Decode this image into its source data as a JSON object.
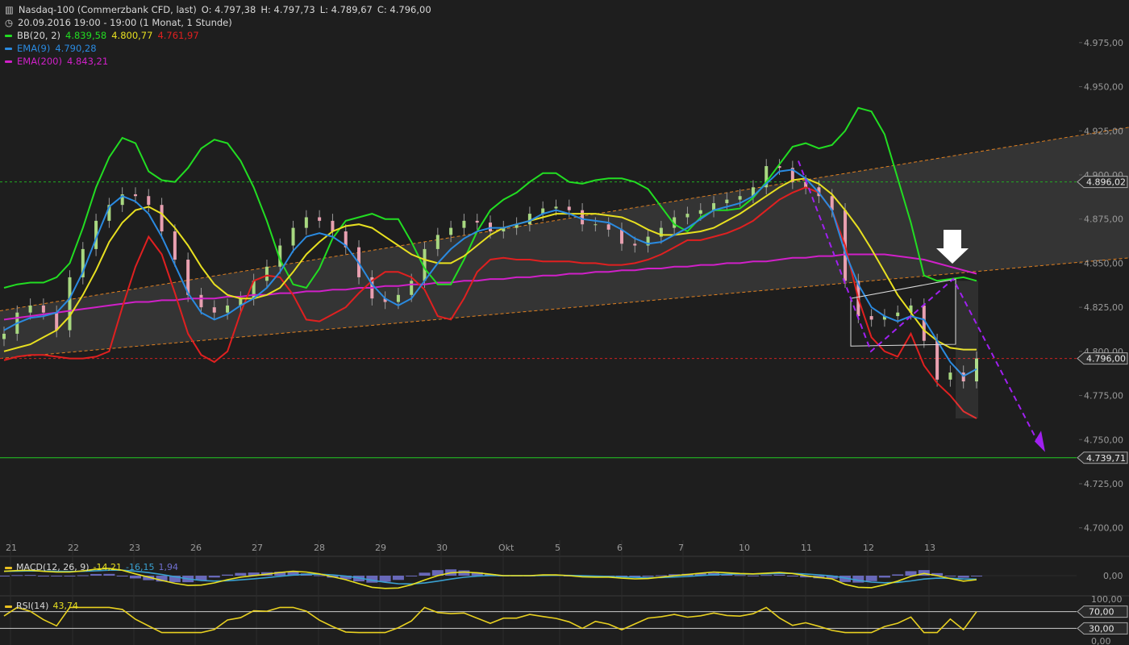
{
  "header": {
    "title": "Nasdaq-100 (Commerzbank CFD, last)",
    "ohlc": {
      "o": "O: 4.797,38",
      "h": "H: 4.797,73",
      "l": "L: 4.789,67",
      "c": "C: 4.796,00"
    },
    "period": "20.09.2016 19:00 - 19:00 (1 Monat, 1 Stunde)"
  },
  "legend": [
    {
      "name": "BB(20, 2)",
      "values": [
        "4.839,58",
        "4.800,77",
        "4.761,97"
      ],
      "colors": [
        "#22dd22",
        "#e8e020",
        "#e02020"
      ]
    },
    {
      "name": "EMA(9)",
      "values": [
        "4.790,28"
      ],
      "colors": [
        "#2a8ae0"
      ]
    },
    {
      "name": "EMA(200)",
      "values": [
        "4.843,21"
      ],
      "colors": [
        "#d020c8"
      ]
    }
  ],
  "macd_label": {
    "name": "MACD(12, 26, 9)",
    "v1": "-14,21",
    "v2": "-16,15",
    "v3": "1,94"
  },
  "rsi_label": {
    "name": "RSI(14)",
    "value": "43,74"
  },
  "chart_data": {
    "type": "candlestick",
    "y_axis": {
      "ticks": [
        "4.975,00",
        "4.950,00",
        "4.925,00",
        "4.900,00",
        "4.875,00",
        "4.850,00",
        "4.825,00",
        "4.800,00",
        "4.775,00",
        "4.750,00",
        "4.725,00",
        "4.700,00"
      ],
      "tick_values": [
        4975,
        4950,
        4925,
        4900,
        4875,
        4850,
        4825,
        4800,
        4775,
        4750,
        4725,
        4700
      ],
      "range": [
        4693,
        4990
      ]
    },
    "x_axis": {
      "labels": [
        "21",
        "22",
        "23",
        "26",
        "27",
        "28",
        "29",
        "30",
        "Okt",
        "5",
        "6",
        "7",
        "10",
        "11",
        "12",
        "13"
      ]
    },
    "price_markers": [
      {
        "label": "4.896,02",
        "value": 4896.02,
        "color": "#22aa22",
        "style": "dashed"
      },
      {
        "label": "4.796,00",
        "value": 4796.0,
        "color": "#cc2020",
        "style": "dashed"
      },
      {
        "label": "4.739,71",
        "value": 4739.71,
        "color": "#22cc22",
        "style": "solid"
      }
    ],
    "series": {
      "bb_upper": [
        4836,
        4838,
        4839,
        4839,
        4842,
        4850,
        4870,
        4893,
        4910,
        4921,
        4918,
        4902,
        4897,
        4896,
        4904,
        4915,
        4920,
        4918,
        4908,
        4893,
        4874,
        4852,
        4838,
        4836,
        4847,
        4864,
        4874,
        4876,
        4878,
        4875,
        4875,
        4862,
        4847,
        4838,
        4838,
        4852,
        4868,
        4880,
        4886,
        4890,
        4896,
        4901,
        4901,
        4896,
        4895,
        4897,
        4898,
        4898,
        4896,
        4892,
        4882,
        4872,
        4868,
        4876,
        4880,
        4880,
        4881,
        4887,
        4896,
        4906,
        4916,
        4918,
        4915,
        4917,
        4925,
        4938,
        4936,
        4923,
        4898,
        4873,
        4843,
        4840,
        4841,
        4842,
        4840
      ],
      "bb_middle": [
        4800,
        4802,
        4804,
        4808,
        4812,
        4820,
        4832,
        4846,
        4862,
        4873,
        4880,
        4882,
        4878,
        4870,
        4860,
        4848,
        4838,
        4832,
        4830,
        4830,
        4832,
        4836,
        4845,
        4855,
        4862,
        4868,
        4871,
        4872,
        4870,
        4865,
        4860,
        4855,
        4852,
        4850,
        4850,
        4854,
        4860,
        4866,
        4870,
        4872,
        4874,
        4876,
        4878,
        4878,
        4878,
        4878,
        4877,
        4876,
        4873,
        4869,
        4866,
        4866,
        4867,
        4868,
        4870,
        4874,
        4878,
        4883,
        4888,
        4893,
        4897,
        4898,
        4895,
        4889,
        4880,
        4870,
        4858,
        4845,
        4832,
        4822,
        4812,
        4806,
        4802,
        4801,
        4801
      ],
      "bb_lower": [
        4795,
        4797,
        4798,
        4798,
        4797,
        4796,
        4796,
        4797,
        4800,
        4825,
        4848,
        4865,
        4855,
        4833,
        4810,
        4798,
        4794,
        4800,
        4822,
        4840,
        4843,
        4842,
        4832,
        4818,
        4817,
        4821,
        4825,
        4833,
        4840,
        4845,
        4845,
        4842,
        4835,
        4820,
        4818,
        4830,
        4845,
        4852,
        4853,
        4852,
        4852,
        4851,
        4851,
        4851,
        4850,
        4850,
        4849,
        4849,
        4850,
        4852,
        4855,
        4859,
        4863,
        4863,
        4865,
        4867,
        4870,
        4874,
        4880,
        4886,
        4890,
        4893,
        4890,
        4880,
        4860,
        4830,
        4808,
        4800,
        4797,
        4810,
        4792,
        4782,
        4775,
        4766,
        4762
      ],
      "ema9": [
        4812,
        4816,
        4819,
        4820,
        4822,
        4830,
        4845,
        4864,
        4882,
        4888,
        4885,
        4878,
        4865,
        4849,
        4833,
        4822,
        4818,
        4821,
        4826,
        4830,
        4836,
        4845,
        4857,
        4865,
        4867,
        4865,
        4860,
        4850,
        4838,
        4830,
        4826,
        4830,
        4840,
        4850,
        4858,
        4864,
        4868,
        4870,
        4870,
        4872,
        4874,
        4878,
        4880,
        4878,
        4875,
        4874,
        4873,
        4869,
        4864,
        4861,
        4862,
        4866,
        4870,
        4875,
        4880,
        4882,
        4884,
        4888,
        4895,
        4902,
        4903,
        4898,
        4890,
        4880,
        4856,
        4838,
        4825,
        4820,
        4817,
        4820,
        4818,
        4806,
        4794,
        4786,
        4790
      ],
      "ema200": [
        4818,
        4819,
        4820,
        4821,
        4822,
        4823,
        4824,
        4825,
        4826,
        4827,
        4828,
        4828,
        4829,
        4829,
        4830,
        4830,
        4830,
        4831,
        4831,
        4832,
        4832,
        4833,
        4833,
        4834,
        4834,
        4835,
        4835,
        4836,
        4836,
        4837,
        4837,
        4838,
        4838,
        4839,
        4839,
        4840,
        4840,
        4841,
        4841,
        4842,
        4842,
        4843,
        4843,
        4844,
        4844,
        4845,
        4845,
        4846,
        4846,
        4847,
        4847,
        4848,
        4848,
        4849,
        4849,
        4850,
        4850,
        4851,
        4851,
        4852,
        4853,
        4853,
        4854,
        4854,
        4855,
        4855,
        4855,
        4855,
        4854,
        4853,
        4852,
        4850,
        4848,
        4846,
        4844
      ],
      "close": [
        4810,
        4822,
        4826,
        4822,
        4812,
        4842,
        4858,
        4874,
        4883,
        4889,
        4888,
        4883,
        4868,
        4852,
        4832,
        4825,
        4822,
        4826,
        4830,
        4840,
        4848,
        4860,
        4870,
        4876,
        4874,
        4868,
        4859,
        4842,
        4830,
        4828,
        4832,
        4840,
        4858,
        4866,
        4870,
        4874,
        4873,
        4868,
        4870,
        4872,
        4878,
        4881,
        4882,
        4880,
        4872,
        4872,
        4869,
        4861,
        4860,
        4865,
        4870,
        4876,
        4878,
        4880,
        4884,
        4886,
        4888,
        4893,
        4905,
        4904,
        4896,
        4893,
        4888,
        4880,
        4840,
        4820,
        4818,
        4820,
        4822,
        4826,
        4806,
        4784,
        4788,
        4783,
        4796
      ]
    },
    "annotations": [
      "arrow-down",
      "channel",
      "projection-arrow"
    ]
  },
  "macd": {
    "axis_ticks": [
      "0,00"
    ]
  },
  "rsi": {
    "axis_ticks": [
      "100,00",
      "70,00",
      "30,00",
      "0,00"
    ]
  }
}
